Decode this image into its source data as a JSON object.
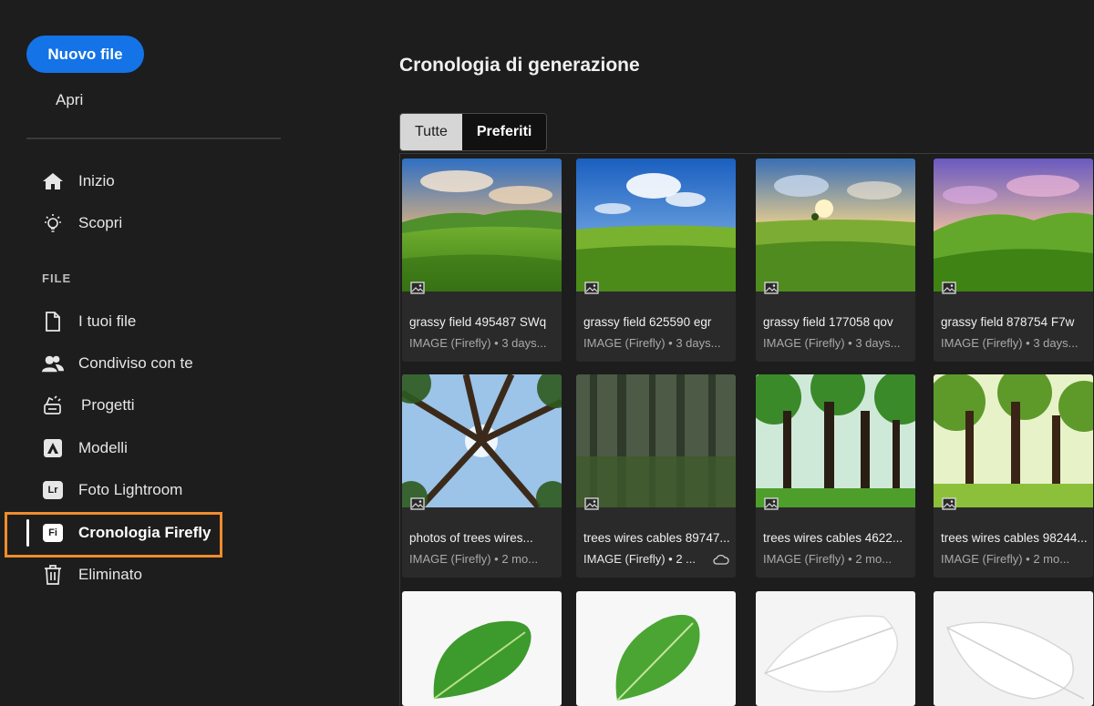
{
  "sidebar": {
    "new_file": "Nuovo file",
    "open": "Apri",
    "nav_top": [
      {
        "label": "Inizio",
        "icon": "home-icon"
      },
      {
        "label": "Scopri",
        "icon": "lightbulb-icon"
      }
    ],
    "section_label": "FILE",
    "nav_files": [
      {
        "label": "I tuoi file",
        "icon": "file-icon"
      },
      {
        "label": "Condiviso con te",
        "icon": "people-icon"
      },
      {
        "label": "Progetti",
        "icon": "projects-icon"
      },
      {
        "label": "Modelli",
        "icon": "templates-icon"
      },
      {
        "label": "Foto Lightroom",
        "icon": "lightroom-icon",
        "badge": "Lr"
      },
      {
        "label": "Cronologia Firefly",
        "icon": "firefly-icon",
        "badge": "Fi",
        "active": true
      },
      {
        "label": "Eliminato",
        "icon": "trash-icon"
      }
    ],
    "highlight_color": "#f08c2c",
    "accent": "#1473e6"
  },
  "main": {
    "title": "Cronologia di generazione",
    "tabs": [
      {
        "label": "Tutte",
        "selected": true
      },
      {
        "label": "Preferiti",
        "selected": false
      }
    ],
    "cards": [
      {
        "name": "grassy field 495487 SWq",
        "meta": "IMAGE (Firefly) • 3 days...",
        "thumb": "field-a"
      },
      {
        "name": "grassy field 625590 egr",
        "meta": "IMAGE (Firefly) • 3 days...",
        "thumb": "field-b"
      },
      {
        "name": "grassy field 177058 qov",
        "meta": "IMAGE (Firefly) • 3 days...",
        "thumb": "field-c"
      },
      {
        "name": "grassy field 878754 F7w",
        "meta": "IMAGE (Firefly) • 3 days...",
        "thumb": "field-d"
      },
      {
        "name": "photos of trees wires...",
        "meta": "IMAGE (Firefly) • 2 mo...",
        "thumb": "trees-up"
      },
      {
        "name": "trees wires cables 89747...",
        "meta": "IMAGE (Firefly) • 2 ...",
        "thumb": "trees-dark",
        "cloud": true
      },
      {
        "name": "trees wires cables 4622...",
        "meta": "IMAGE (Firefly) • 2 mo...",
        "thumb": "trees-green"
      },
      {
        "name": "trees wires cables 98244...",
        "meta": "IMAGE (Firefly) • 2 mo...",
        "thumb": "trees-light"
      },
      {
        "name": "",
        "meta": "",
        "thumb": "leaf-green"
      },
      {
        "name": "",
        "meta": "",
        "thumb": "leaf-green2"
      },
      {
        "name": "",
        "meta": "",
        "thumb": "leaf-white"
      },
      {
        "name": "",
        "meta": "",
        "thumb": "leaf-white2"
      }
    ]
  }
}
